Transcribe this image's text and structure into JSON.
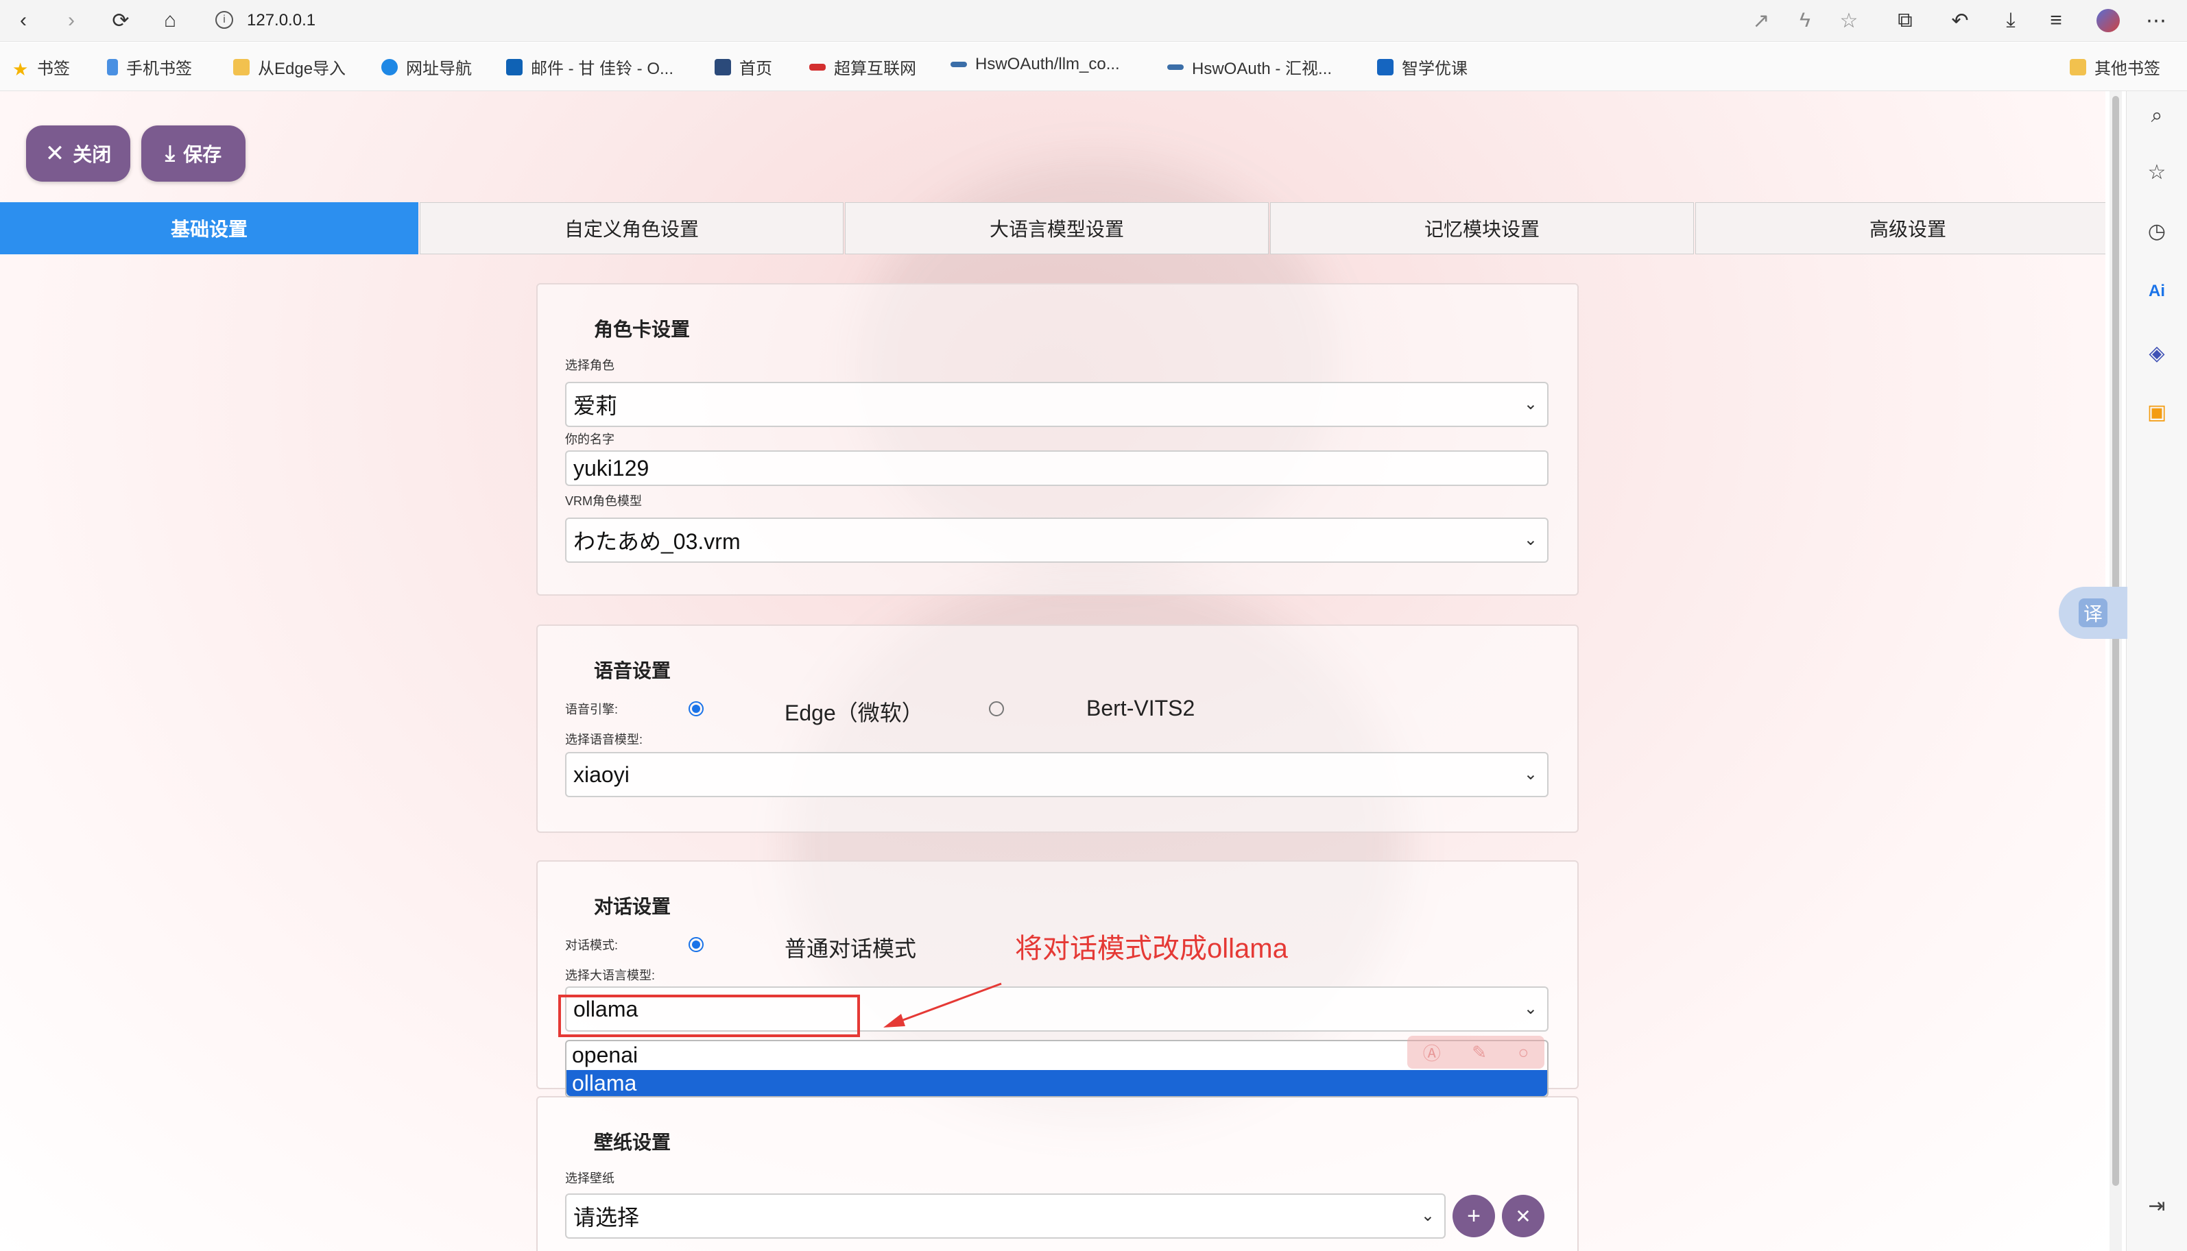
{
  "browser": {
    "url": "127.0.0.1",
    "bookmarks": [
      "书签",
      "手机书签",
      "从Edge导入",
      "网址导航",
      "邮件 - 甘 佳铃 - O...",
      "首页",
      "超算互联网",
      "HswOAuth/llm_co...",
      "HswOAuth - 汇视...",
      "智学优课"
    ],
    "other_bookmarks": "其他书签"
  },
  "toolbar": {
    "close_label": "关闭",
    "save_label": "保存"
  },
  "tabs": [
    "基础设置",
    "自定义角色设置",
    "大语言模型设置",
    "记忆模块设置",
    "高级设置"
  ],
  "character": {
    "title": "角色卡设置",
    "select_label": "选择角色",
    "select_value": "爱莉",
    "name_label": "你的名字",
    "name_value": "yuki129",
    "vrm_label": "VRM角色模型",
    "vrm_value": "わたあめ_03.vrm"
  },
  "voice": {
    "title": "语音设置",
    "engine_label": "语音引擎:",
    "engine_options": [
      "Edge（微软）",
      "Bert-VITS2"
    ],
    "model_label": "选择语音模型:",
    "model_value": "xiaoyi"
  },
  "dialog": {
    "title": "对话设置",
    "mode_label": "对话模式:",
    "mode_option": "普通对话模式",
    "llm_label": "选择大语言模型:",
    "llm_value": "ollama",
    "dropdown_options": [
      "openai",
      "ollama"
    ],
    "annotation": "将对话模式改成ollama"
  },
  "wallpaper": {
    "title": "壁纸设置",
    "select_label": "选择壁纸",
    "select_value": "请选择"
  },
  "translate_label": "译",
  "colors": {
    "accent": "#2c8fef",
    "button": "#7b5b8f",
    "annotation": "#e53935"
  }
}
